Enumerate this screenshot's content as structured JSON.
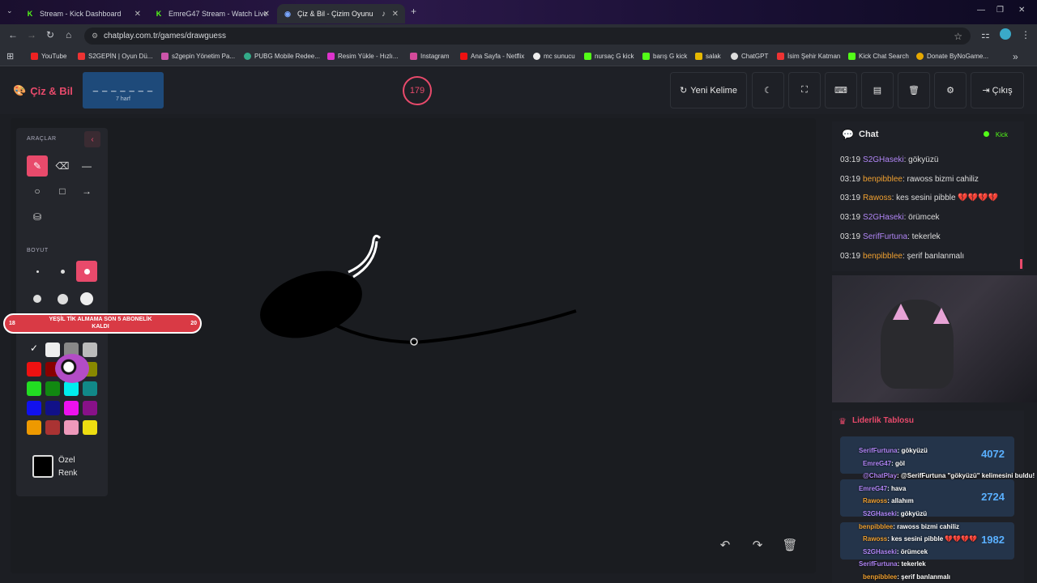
{
  "tabs": [
    {
      "title": "Stream - Kick Dashboard",
      "fav": "K",
      "color": "#53fc18"
    },
    {
      "title": "EmreG47 Stream - Watch Live",
      "fav": "K",
      "color": "#53fc18"
    },
    {
      "title": "Çiz & Bil - Çizim Oyunu",
      "fav": "CP",
      "color": "#7aa7ff"
    }
  ],
  "url": "chatplay.com.tr/games/drawguess",
  "bookmarks": [
    "YouTube",
    "S2GEPİN | Oyun Dü...",
    "s2gepin Yönetim Pa...",
    "PUBG Mobile Redee...",
    "Resim Yükle - Hızlı...",
    "Instagram",
    "Ana Sayfa - Netflix",
    "mc sunucu",
    "nursaç G kick",
    "barış G kick",
    "salak",
    "ChatGPT",
    "İsim Şehir Katman",
    "Kick Chat Search",
    "Donate ByNoGame..."
  ],
  "header": {
    "logo": "Çiz & Bil",
    "word_hint": "_ _ _ _ _ _ _",
    "word_length": "7 harf",
    "timer": "179",
    "new_word": "Yeni Kelime",
    "exit": "Çıkış"
  },
  "tools": {
    "title": "ARAÇLAR",
    "size_title": "BOYUT",
    "custom_color": "Özel",
    "custom_color2": "Renk"
  },
  "alert": {
    "left": "18",
    "text": "YEŞİL TİK ALMAMA SON 5 ABONELİK",
    "text2": "KALDI",
    "right": "20"
  },
  "chat": {
    "title": "Chat",
    "source": "Kick",
    "messages": [
      {
        "time": "03:19",
        "user": "S2GHaseki",
        "msg": ": gökyüzü",
        "color": "#b085f5"
      },
      {
        "time": "03:19",
        "user": "benpibblee",
        "msg": ": rawoss bizmi cahiliz",
        "color": "#f0a030"
      },
      {
        "time": "03:19",
        "user": "Rawoss",
        "msg": ": kes sesini pibble 💔💔💔💔",
        "color": "#f0a030"
      },
      {
        "time": "03:19",
        "user": "S2GHaseki",
        "msg": ": örümcek",
        "color": "#b085f5"
      },
      {
        "time": "03:19",
        "user": "SerifFurtuna",
        "msg": ": tekerlek",
        "color": "#b085f5"
      },
      {
        "time": "03:19",
        "user": "benpibblee",
        "msg": ": şerif banlanmalı",
        "color": "#f0a030"
      }
    ]
  },
  "leader": {
    "title": "Liderlik Tablosu",
    "scores": [
      "4072",
      "2724",
      "1982"
    ]
  },
  "overlay_chat": [
    {
      "user": "SerifFurtuna",
      "msg": ": gökyüzü",
      "color": "#b085f5"
    },
    {
      "user": "EmreG47",
      "msg": ": göl",
      "color": "#b085f5"
    },
    {
      "user": "@ChatPlay",
      "msg": ": @SerifFurtuna \"gökyüzü\" kelimesini buldu!",
      "color": "#b085f5"
    },
    {
      "user": "EmreG47",
      "msg": ": hava",
      "color": "#b085f5"
    },
    {
      "user": "Rawoss",
      "msg": ": allahım",
      "color": "#f0a030"
    },
    {
      "user": "S2GHaseki",
      "msg": ": gökyüzü",
      "color": "#b085f5"
    },
    {
      "user": "benpibblee",
      "msg": ": rawoss bizmi cahiliz",
      "color": "#f0a030"
    },
    {
      "user": "Rawoss",
      "msg": ": kes sesini pibble 💔💔💔💔",
      "color": "#f0a030"
    },
    {
      "user": "S2GHaseki",
      "msg": ": örümcek",
      "color": "#b085f5"
    },
    {
      "user": "SerifFurtuna",
      "msg": ": tekerlek",
      "color": "#b085f5"
    },
    {
      "user": "benpibblee",
      "msg": ": şerif banlanmalı",
      "color": "#f0a030"
    }
  ]
}
